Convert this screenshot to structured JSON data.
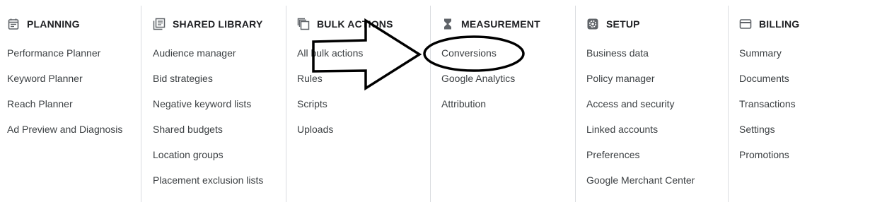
{
  "columns": [
    {
      "title": "PLANNING",
      "icon": "calendar-icon",
      "items": [
        "Performance Planner",
        "Keyword Planner",
        "Reach Planner",
        "Ad Preview and Diagnosis"
      ]
    },
    {
      "title": "SHARED LIBRARY",
      "icon": "library-icon",
      "items": [
        "Audience manager",
        "Bid strategies",
        "Negative keyword lists",
        "Shared budgets",
        "Location groups",
        "Placement exclusion lists"
      ]
    },
    {
      "title": "BULK ACTIONS",
      "icon": "copy-icon",
      "items": [
        "All bulk actions",
        "Rules",
        "Scripts",
        "Uploads"
      ]
    },
    {
      "title": "MEASUREMENT",
      "icon": "hourglass-icon",
      "items": [
        "Conversions",
        "Google Analytics",
        "Attribution"
      ]
    },
    {
      "title": "SETUP",
      "icon": "gear-icon",
      "items": [
        "Business data",
        "Policy manager",
        "Access and security",
        "Linked accounts",
        "Preferences",
        "Google Merchant Center"
      ]
    },
    {
      "title": "BILLING",
      "icon": "credit-card-icon",
      "items": [
        "Summary",
        "Documents",
        "Transactions",
        "Settings",
        "Promotions"
      ]
    }
  ],
  "colors": {
    "icon": "#5f6368",
    "title": "#202124",
    "text": "#3c4043",
    "divider": "#dadce0",
    "annotation": "#000000"
  }
}
